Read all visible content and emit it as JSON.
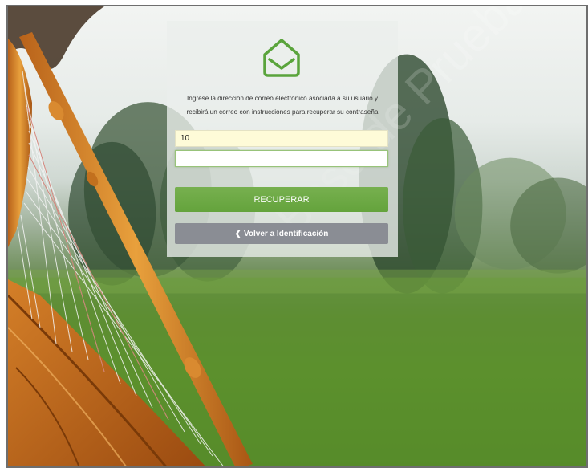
{
  "form": {
    "instructions": "Ingrese la dirección de correo electrónico asociada a su usuario y recibirá un correo con instrucciones para recuperar su contraseña",
    "field_one_value": "10",
    "field_two_value": "",
    "recover_label": "RECUPERAR",
    "back_label": "Volver a Identificación",
    "back_icon": "chevron-left-icon",
    "logo_icon": "envelope-house-icon"
  },
  "background": {
    "watermark_text": "Base de Pruebas"
  },
  "colors": {
    "primary_green": "#6aa842",
    "back_gray": "#8a8d94",
    "field_yellow": "#fefbd8"
  }
}
